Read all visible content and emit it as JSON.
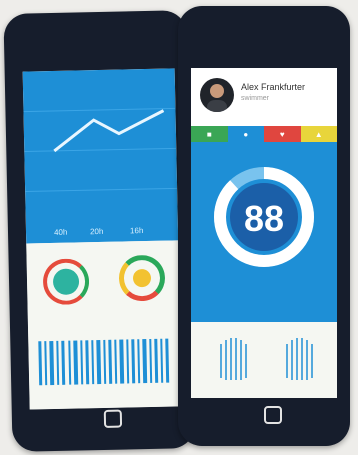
{
  "left_phone": {
    "chart_ticks": [
      "40h",
      "20h",
      "16h"
    ]
  },
  "right_phone": {
    "profile": {
      "name": "Alex Frankfurter",
      "subtitle": "swimmer"
    },
    "score": {
      "value": "88",
      "progress": 0.88
    }
  },
  "colors": {
    "accent_blue": "#1e8fd6",
    "phone_body": "#161d2c",
    "tab_colors": [
      "#3aa655",
      "#1e8fd6",
      "#e0463f",
      "#e8d53b"
    ],
    "ring_teal": "#2db3a0",
    "ring_green": "#2aa85a",
    "ring_red": "#e54b3c",
    "ring_yellow": "#f2c230"
  }
}
